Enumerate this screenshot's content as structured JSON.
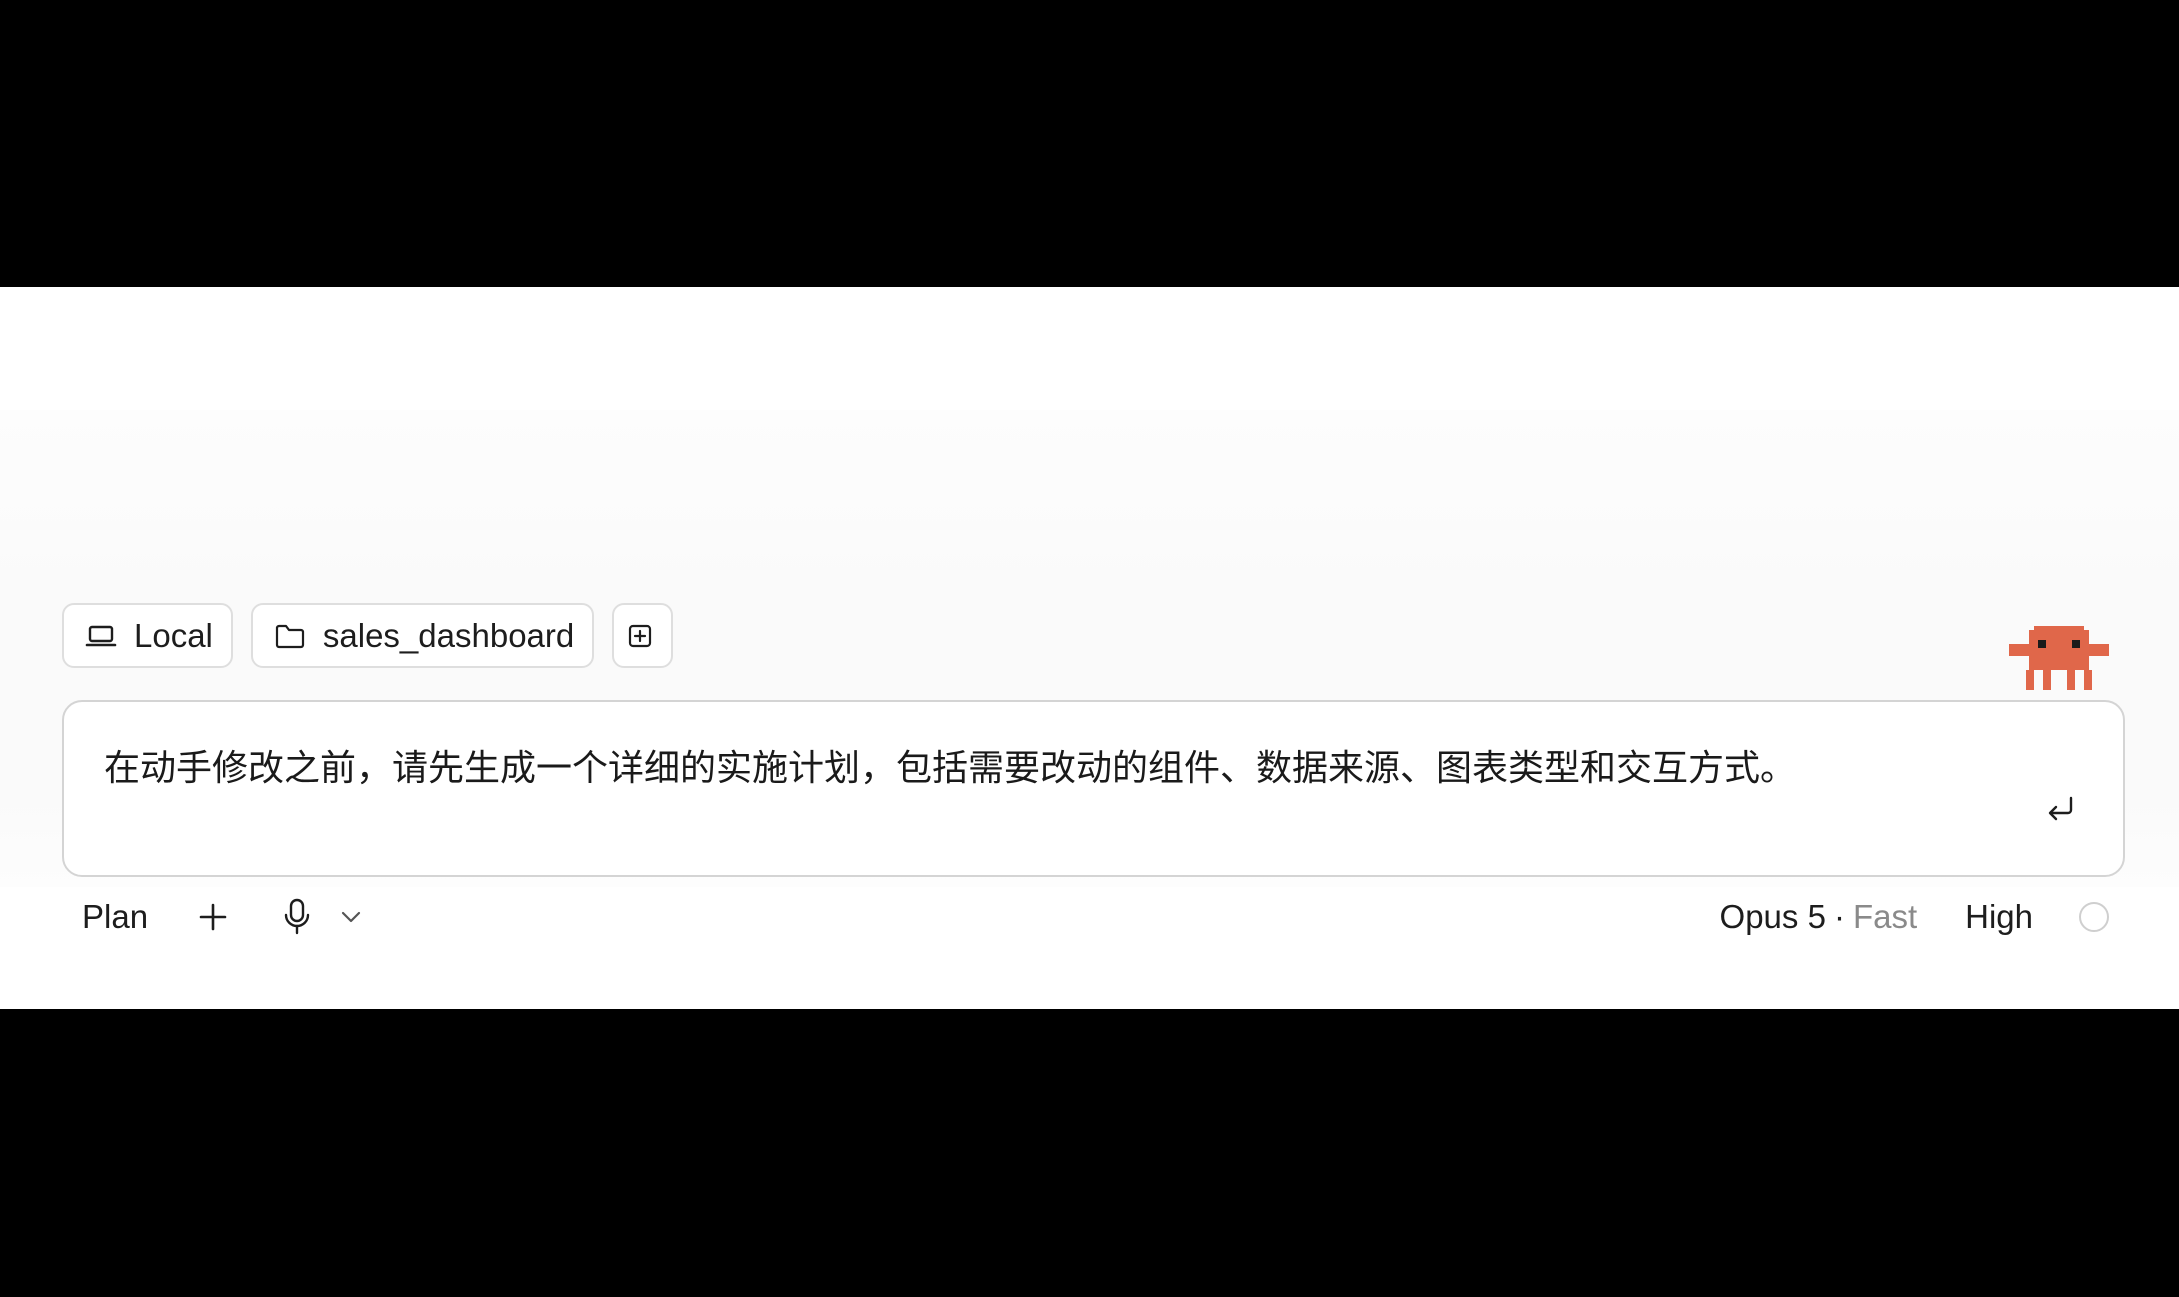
{
  "header": {
    "environment_label": "Local",
    "environment_icon": "laptop-icon",
    "project_label": "sales_dashboard",
    "project_icon": "folder-icon",
    "add_context_icon": "square-plus-icon"
  },
  "mascot_icon": "pixel-crab-mascot",
  "composer": {
    "text": "在动手修改之前，请先生成一个详细的实施计划，包括需要改动的组件、数据来源、图表类型和交互方式。",
    "submit_icon": "enter-return-icon"
  },
  "toolbar": {
    "mode_label": "Plan",
    "add_icon": "plus-icon",
    "mic_icon": "microphone-icon",
    "dropdown_icon": "chevron-down-icon",
    "model_name": "Opus 5",
    "model_separator": "·",
    "model_speed": "Fast",
    "effort_label": "High",
    "status_icon": "circle-status-icon"
  },
  "colors": {
    "background_outer": "#000000",
    "panel": "#ffffff",
    "composer_area": "#fafafa",
    "mascot": "#e0674a",
    "muted_text": "#8a8a8a",
    "border": "#d4d4d4"
  }
}
